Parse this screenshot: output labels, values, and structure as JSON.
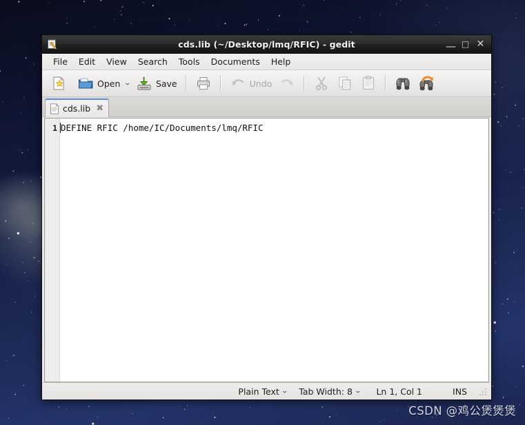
{
  "window": {
    "title": "cds.lib (~/Desktop/lmq/RFIC) - gedit",
    "app_icon": "notepad-pencil-icon",
    "controls": {
      "minimize": "—",
      "maximize": "□",
      "close": "✕"
    }
  },
  "menubar": {
    "items": [
      {
        "label": "File"
      },
      {
        "label": "Edit"
      },
      {
        "label": "View"
      },
      {
        "label": "Search"
      },
      {
        "label": "Tools"
      },
      {
        "label": "Documents"
      },
      {
        "label": "Help"
      }
    ]
  },
  "toolbar": {
    "new_label": "",
    "new_icon": "new-document-icon",
    "open_label": "Open",
    "open_icon": "open-folder-icon",
    "open_dropdown_glyph": "⌄",
    "save_label": "Save",
    "save_icon": "save-disk-icon",
    "print_icon": "print-icon",
    "undo_label": "Undo",
    "undo_icon": "undo-arrow-icon",
    "redo_icon": "redo-arrow-icon",
    "cut_icon": "scissors-icon",
    "copy_icon": "copy-icon",
    "paste_icon": "paste-clipboard-icon",
    "find_icon": "binoculars-icon",
    "replace_icon": "binoculars-replace-icon"
  },
  "tabs": [
    {
      "label": "cds.lib",
      "icon": "text-document-icon",
      "close_glyph": "✖"
    }
  ],
  "editor": {
    "lines": [
      {
        "number": "1",
        "text": "DEFINE RFIC /home/IC/Documents/lmq/RFIC"
      }
    ]
  },
  "statusbar": {
    "language": "Plain Text",
    "language_caret": "⌄",
    "tab_width_label": "Tab Width:",
    "tab_width_value": "8",
    "tab_width_caret": "⌄",
    "cursor_position": "Ln 1, Col 1",
    "insert_mode": "INS"
  },
  "watermark": {
    "text": "CSDN @鸡公煲煲煲"
  },
  "colors": {
    "titlebar_dark": "#2c2c2c",
    "tab_accent": "#5b8dd6",
    "editor_background": "#ffffff",
    "gutter_background": "#ededed",
    "chrome_background": "#ececeb",
    "desktop_deep_blue": "#101736"
  }
}
